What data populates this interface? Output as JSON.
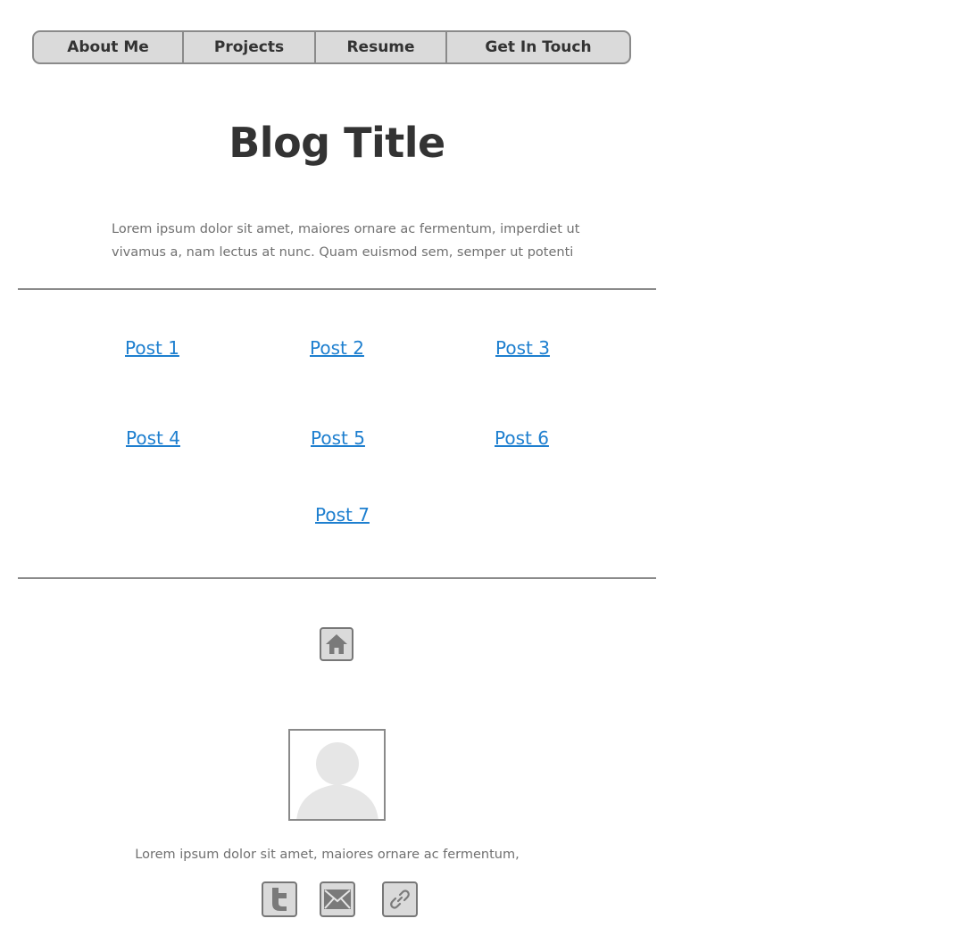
{
  "nav": {
    "items": [
      {
        "label": "About Me"
      },
      {
        "label": "Projects"
      },
      {
        "label": "Resume"
      },
      {
        "label": "Get In Touch"
      }
    ]
  },
  "header": {
    "title": "Blog Title",
    "intro": "Lorem ipsum dolor sit amet, maiores ornare ac fermentum, imperdiet ut vivamus a, nam lectus at nunc. Quam euismod sem, semper ut potenti"
  },
  "posts": [
    {
      "label": "Post 1"
    },
    {
      "label": "Post 2"
    },
    {
      "label": "Post 3"
    },
    {
      "label": "Post 4"
    },
    {
      "label": "Post 5"
    },
    {
      "label": "Post 6"
    },
    {
      "label": "Post 7"
    }
  ],
  "home": {
    "icon": "home-icon"
  },
  "footer": {
    "text": "Lorem ipsum dolor sit amet, maiores ornare ac fermentum,",
    "social": [
      {
        "icon": "twitter-icon"
      },
      {
        "icon": "mail-icon"
      },
      {
        "icon": "link-icon"
      }
    ]
  },
  "colors": {
    "link": "#1e7fcf",
    "nav_bg": "#dadada",
    "border": "#8a8a8a",
    "heading": "#333333",
    "muted_text": "#707070"
  }
}
